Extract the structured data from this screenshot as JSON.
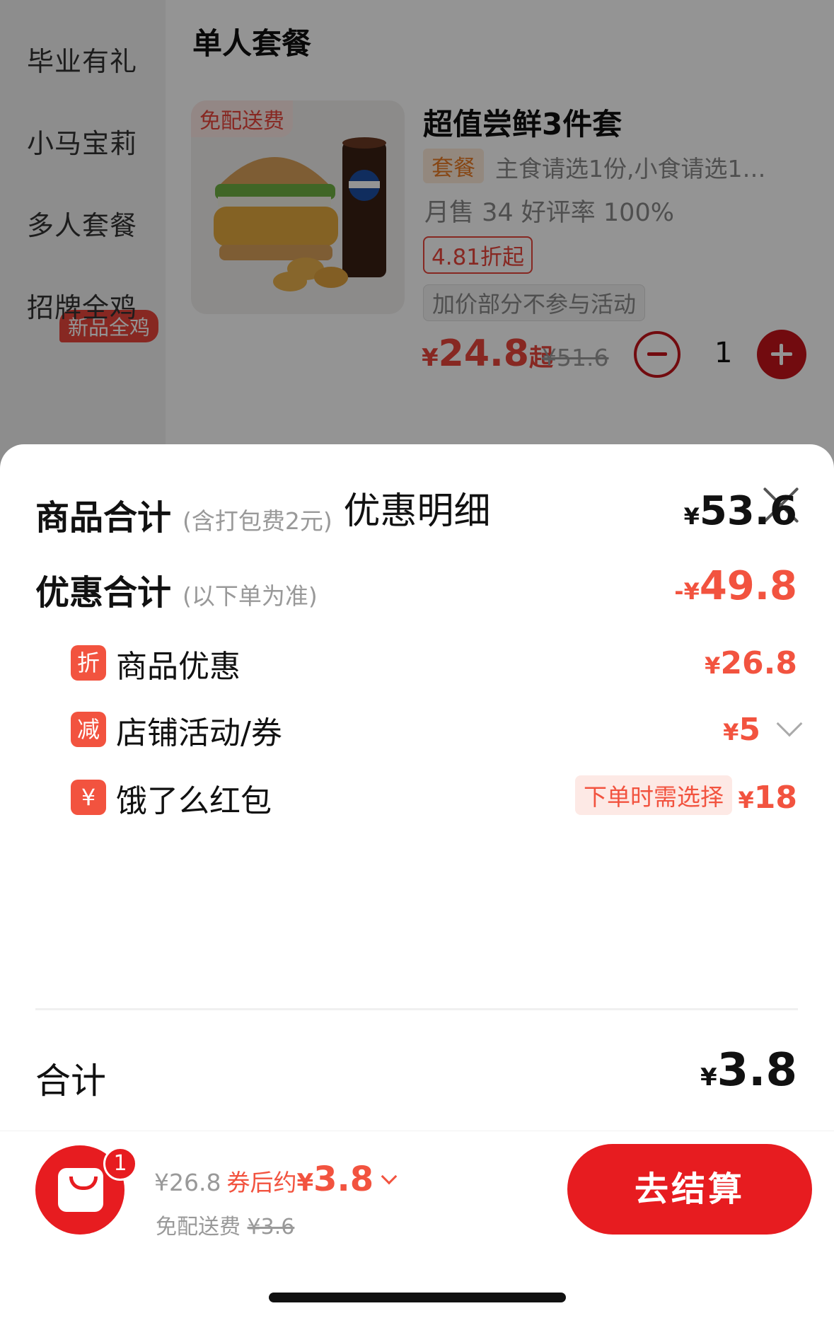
{
  "sidebar": {
    "items": [
      "毕业有礼",
      "小马宝莉",
      "多人套餐",
      "招牌全鸡"
    ],
    "badge": "新品全鸡"
  },
  "section_title": "单人套餐",
  "product": {
    "free_tag": "免配送费",
    "name": "超值尝鲜3件套",
    "combo_tag": "套餐",
    "desc": "主食请选1份,小食请选1…",
    "sales": "月售 34 好评率 100%",
    "discount_tag": "4.81折起",
    "activity_tag": "加价部分不参与活动",
    "price_yen": "¥",
    "price": "24.8",
    "price_suffix": "起",
    "old_price": "¥51.6",
    "quantity": "1"
  },
  "sheet": {
    "title": "优惠明细",
    "goods_total": {
      "label": "商品合计",
      "sub": "(含打包费2元)",
      "yen": "¥",
      "value": "53.6"
    },
    "discount_total": {
      "label": "优惠合计",
      "sub": "(以下单为准)",
      "yen": "-¥",
      "value": "49.8"
    },
    "items": [
      {
        "icon": "折",
        "label": "商品优惠",
        "yen": "¥",
        "value": "26.8"
      },
      {
        "icon": "减",
        "label": "店铺活动/券",
        "yen": "¥",
        "value": "5"
      },
      {
        "icon": "¥",
        "label": "饿了么红包",
        "tag": "下单时需选择",
        "yen": "¥",
        "value": "18"
      }
    ],
    "total": {
      "label": "合计",
      "yen": "¥",
      "value": "3.8"
    }
  },
  "cart": {
    "count": "1",
    "original": "¥26.8",
    "after_label": "券后约",
    "yen": "¥",
    "after_value": "3.8",
    "delivery_label": "免配送费",
    "delivery_old": "¥3.6",
    "checkout_label": "去结算"
  },
  "colors": {
    "accent_red": "#e71c20",
    "discount_red": "#f2533f",
    "gray_text": "#999999"
  }
}
